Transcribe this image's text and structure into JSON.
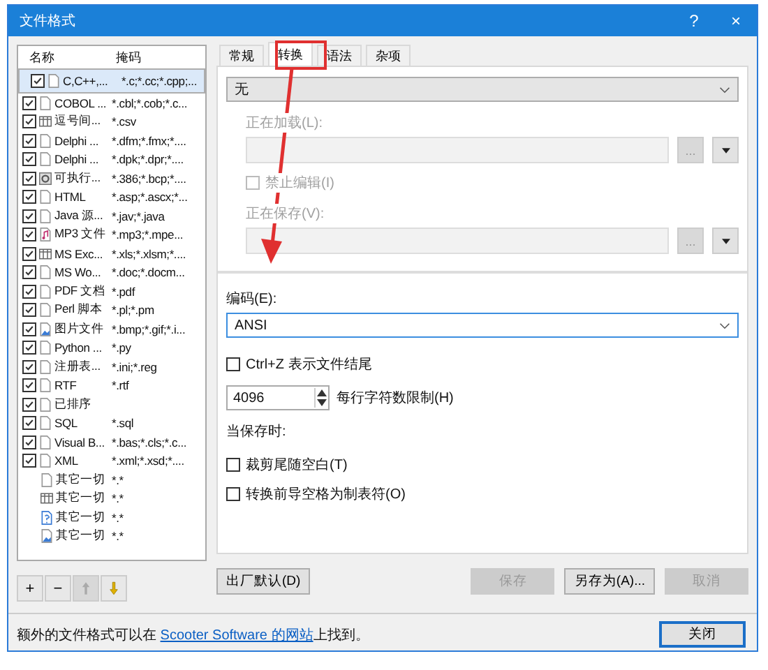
{
  "window": {
    "title": "文件格式",
    "help": "?",
    "close": "×"
  },
  "list": {
    "columns": [
      "名称",
      "掩码"
    ],
    "rows": [
      {
        "name": "C,C++,...",
        "mask": "*.c;*.cc;*.cpp;...",
        "kind": "file",
        "checked": true,
        "selected": true
      },
      {
        "name": "COBOL ...",
        "mask": "*.cbl;*.cob;*.c...",
        "kind": "file",
        "checked": true,
        "selected": false
      },
      {
        "name": "逗号间...",
        "mask": "*.csv",
        "kind": "table",
        "checked": true,
        "selected": false
      },
      {
        "name": "Delphi ...",
        "mask": "*.dfm;*.fmx;*....",
        "kind": "file",
        "checked": true,
        "selected": false
      },
      {
        "name": "Delphi ...",
        "mask": "*.dpk;*.dpr;*....",
        "kind": "file",
        "checked": true,
        "selected": false
      },
      {
        "name": "可执行...",
        "mask": "*.386;*.bcp;*....",
        "kind": "gear",
        "checked": true,
        "selected": false
      },
      {
        "name": "HTML",
        "mask": "*.asp;*.ascx;*...",
        "kind": "file",
        "checked": true,
        "selected": false
      },
      {
        "name": "Java 源...",
        "mask": "*.jav;*.java",
        "kind": "file",
        "checked": true,
        "selected": false
      },
      {
        "name": "MP3 文件",
        "mask": "*.mp3;*.mpe...",
        "kind": "music",
        "checked": true,
        "selected": false
      },
      {
        "name": "MS Exc...",
        "mask": "*.xls;*.xlsm;*....",
        "kind": "table",
        "checked": true,
        "selected": false
      },
      {
        "name": "MS Wo...",
        "mask": "*.doc;*.docm...",
        "kind": "file",
        "checked": true,
        "selected": false
      },
      {
        "name": "PDF 文档",
        "mask": "*.pdf",
        "kind": "file",
        "checked": true,
        "selected": false
      },
      {
        "name": "Perl 脚本",
        "mask": "*.pl;*.pm",
        "kind": "file",
        "checked": true,
        "selected": false
      },
      {
        "name": "图片文件",
        "mask": "*.bmp;*.gif;*.i...",
        "kind": "image",
        "checked": true,
        "selected": false
      },
      {
        "name": "Python ...",
        "mask": "*.py",
        "kind": "file",
        "checked": true,
        "selected": false
      },
      {
        "name": "注册表...",
        "mask": "*.ini;*.reg",
        "kind": "file",
        "checked": true,
        "selected": false
      },
      {
        "name": "RTF",
        "mask": "*.rtf",
        "kind": "file",
        "checked": true,
        "selected": false
      },
      {
        "name": "已排序",
        "kind": "file",
        "checked": true,
        "selected": false
      },
      {
        "name": "SQL",
        "mask": "*.sql",
        "kind": "file",
        "checked": true,
        "selected": false
      },
      {
        "name": "Visual B...",
        "mask": "*.bas;*.cls;*.c...",
        "kind": "file",
        "checked": true,
        "selected": false
      },
      {
        "name": "XML",
        "mask": "*.xml;*.xsd;*....",
        "kind": "file",
        "checked": true,
        "selected": false
      },
      {
        "name": "其它一切",
        "mask": "*.*",
        "kind": "file",
        "selected": false
      },
      {
        "name": "其它一切",
        "mask": "*.*",
        "kind": "table",
        "selected": false
      },
      {
        "name": "其它一切",
        "mask": "*.*",
        "kind": "script",
        "selected": false
      },
      {
        "name": "其它一切",
        "mask": "*.*",
        "kind": "image",
        "selected": false
      }
    ]
  },
  "list_buttons": [
    {
      "label": "+",
      "disabled": false
    },
    {
      "label": "−",
      "disabled": false
    },
    {
      "kind": "up",
      "disabled": true
    },
    {
      "kind": "down",
      "disabled": false
    }
  ],
  "tabs": [
    {
      "label": "常规",
      "selected": false
    },
    {
      "label": "转换",
      "selected": true
    },
    {
      "label": "语法",
      "selected": false
    },
    {
      "label": "杂项",
      "selected": false
    }
  ],
  "conversion": {
    "value": "无",
    "load_label": "正在加载(L):",
    "browse": "...",
    "no_edit": {
      "label": "禁止编辑(I)",
      "checked": false,
      "disabled": true
    },
    "save_label": "正在保存(V):"
  },
  "encoding": {
    "label": "编码(E):",
    "value": "ANSI"
  },
  "ctrl_z": {
    "label": "Ctrl+Z 表示文件结尾",
    "checked": false
  },
  "line_limit": {
    "value": "4096",
    "label": "每行字符数限制(H)"
  },
  "on_save": {
    "label": "当保存时:",
    "options": [
      {
        "label": "裁剪尾随空白(T)",
        "checked": false
      },
      {
        "label": "转换前导空格为制表符(O)",
        "checked": false
      }
    ]
  },
  "buttons": [
    {
      "label": "出厂默认(D)",
      "disabled": false
    },
    {
      "label": "保存",
      "disabled": true
    },
    {
      "label": "另存为(A)...",
      "disabled": false
    },
    {
      "label": "取消",
      "disabled": true
    }
  ],
  "footer": {
    "before": "额外的文件格式可以在 ",
    "link": "Scooter Software 的网站",
    "after": "上找到。"
  },
  "close_button": "关闭"
}
